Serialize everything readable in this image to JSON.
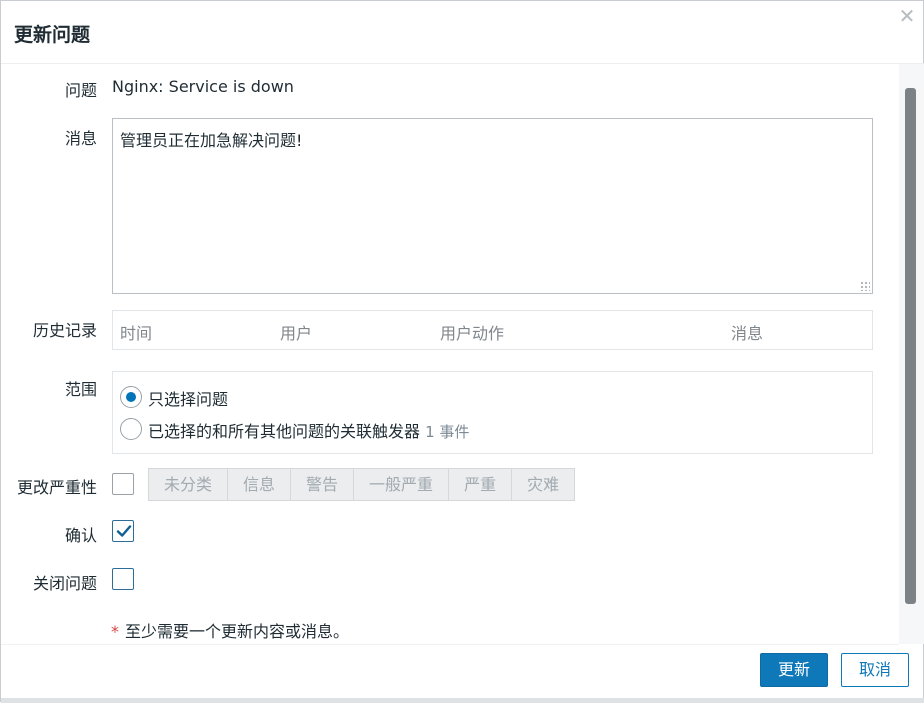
{
  "dialog": {
    "title": "更新问题",
    "close_icon": "close-icon"
  },
  "form": {
    "problem_label": "问题",
    "problem_value": "Nginx: Service is down",
    "message_label": "消息",
    "message_value": "管理员正在加急解决问题!",
    "history_label": "历史记录",
    "history_columns": [
      "时间",
      "用户",
      "用户动作",
      "消息"
    ],
    "scope_label": "范围",
    "scope_options": [
      {
        "label": "只选择问题",
        "selected": true
      },
      {
        "label": "已选择的和所有其他问题的关联触发器",
        "selected": false,
        "event_count": "1 事件"
      }
    ],
    "change_severity_label": "更改严重性",
    "change_severity_checked": false,
    "severities": [
      "未分类",
      "信息",
      "警告",
      "一般严重",
      "严重",
      "灾难"
    ],
    "acknowledge_label": "确认",
    "acknowledge_checked": true,
    "close_problem_label": "关闭问题",
    "close_problem_checked": false,
    "required_note": "至少需要一个更新内容或消息。"
  },
  "buttons": {
    "update": "更新",
    "cancel": "取消"
  },
  "colors": {
    "primary": "#0f78b8",
    "text": "#1f2c33",
    "muted": "#7f878d",
    "required": "#d64541"
  }
}
